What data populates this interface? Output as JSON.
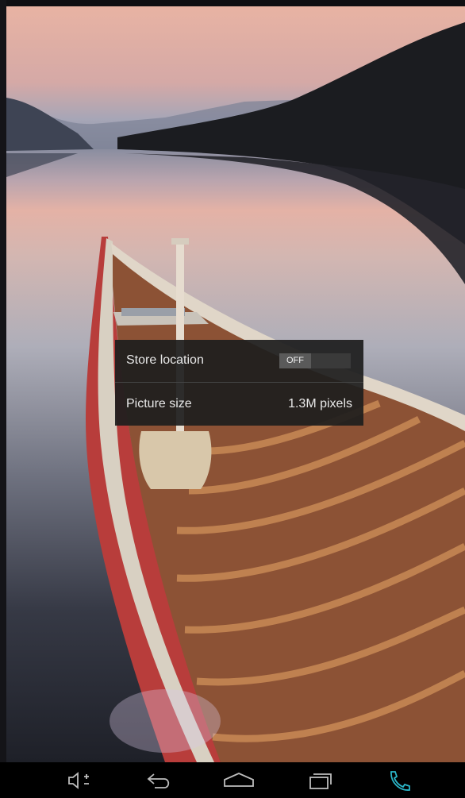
{
  "settings_popup": {
    "store_location": {
      "label": "Store location",
      "toggle_state": "OFF"
    },
    "picture_size": {
      "label": "Picture size",
      "value": "1.3M pixels"
    }
  },
  "nav_bar": {
    "buttons": [
      "volume-icon",
      "back-icon",
      "home-icon",
      "recent-apps-icon",
      "phone-icon"
    ],
    "accent_color": "#2bb5c8"
  }
}
